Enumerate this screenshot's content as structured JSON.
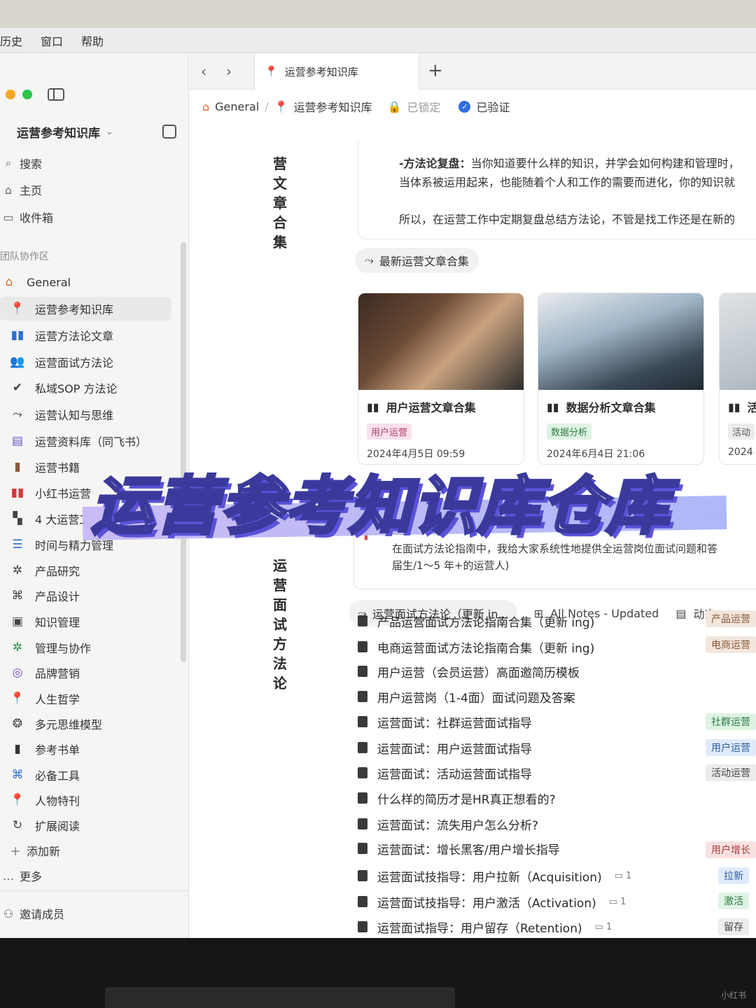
{
  "menubar": {
    "items": [
      "历史",
      "窗口",
      "帮助"
    ]
  },
  "sidebar": {
    "workspace_title": "运营参考知识库",
    "nav": [
      {
        "label": "搜索",
        "icon": "search-icon"
      },
      {
        "label": "主页",
        "icon": "home-icon"
      },
      {
        "label": "收件箱",
        "icon": "inbox-icon"
      }
    ],
    "section_label": "团队协作区",
    "tree": [
      {
        "label": "General",
        "icon": "house-icon"
      },
      {
        "label": "运营参考知识库",
        "icon": "pin-icon"
      },
      {
        "label": "运营方法论文章",
        "icon": "book-icon"
      },
      {
        "label": "运营面试方法论",
        "icon": "people-icon"
      },
      {
        "label": "私域SOP 方法论",
        "icon": "badge-check-icon"
      },
      {
        "label": "运营认知与思维",
        "icon": "route-icon"
      },
      {
        "label": "运营资料库（同飞书）",
        "icon": "folder-icon"
      },
      {
        "label": "运营书籍",
        "icon": "bookmark-icon"
      },
      {
        "label": "小红书运营",
        "icon": "book-open-icon"
      },
      {
        "label": "4 大运营工",
        "icon": "chart-icon"
      },
      {
        "label": "时间与精力管理",
        "icon": "list-icon"
      },
      {
        "label": "产品研究",
        "icon": "gear-icon"
      },
      {
        "label": "产品设计",
        "icon": "command-icon"
      },
      {
        "label": "知识管理",
        "icon": "knowledge-icon"
      },
      {
        "label": "管理与协作",
        "icon": "gear-green-icon"
      },
      {
        "label": "品牌营销",
        "icon": "target-icon"
      },
      {
        "label": "人生哲学",
        "icon": "pin-blue-icon"
      },
      {
        "label": "多元思维模型",
        "icon": "brain-icon"
      },
      {
        "label": "参考书单",
        "icon": "book-dark-icon"
      },
      {
        "label": "必备工具",
        "icon": "command-blue-icon"
      },
      {
        "label": "人物特刊",
        "icon": "pin-red-icon"
      },
      {
        "label": "扩展阅读",
        "icon": "refresh-icon"
      }
    ],
    "add_new": "添加新",
    "more": "更多",
    "invite": "邀请成员"
  },
  "tabs": {
    "active_tab": "运营参考知识库"
  },
  "breadcrumb": {
    "root": "General",
    "page": "运营参考知识库",
    "locked": "已锁定",
    "verified": "已验证"
  },
  "content": {
    "vertical_heading_1": [
      "营",
      "文",
      "章",
      "合",
      "集"
    ],
    "vertical_heading_2": [
      "运",
      "营",
      "面",
      "试",
      "方",
      "法",
      "论"
    ],
    "text_block": {
      "line1_bold": "-方法论复盘：",
      "line1_rest": "当你知道要什么样的知识，并学会如何构建和管理时，",
      "line2": "当体系被运用起来，也能随着个人和工作的需要而进化，你的知识就",
      "line3": "所以，在运营工作中定期复盘总结方法论，不管是找工作还是在新的"
    },
    "gallery_label": "最新运营文章合集",
    "cards": [
      {
        "title": "用户运营文章合集",
        "tag": "用户运营",
        "tag_bg": "#f9e1ec",
        "tag_color": "#b03a6f",
        "date": "2024年4月5日 09:59"
      },
      {
        "title": "数据分析文章合集",
        "tag": "数据分析",
        "tag_bg": "#dff3e4",
        "tag_color": "#2c7a43",
        "date": "2024年6月4日 21:06"
      },
      {
        "title": "活",
        "tag": "活动",
        "tag_bg": "#ececec",
        "tag_color": "#555",
        "date": "2024"
      }
    ],
    "snippet": {
      "line1": "在面试方法论指南中，我给大家系统性地提供全运营岗位面试问题和答",
      "line2": "届生/1～5 年+的运营人)"
    },
    "view_tabs": {
      "active": "运营面试方法论（更新 in...",
      "all_notes": "All Notes - Updated",
      "activity": "动态"
    },
    "list": [
      {
        "title": "产品运营面试方法论指南合集（更新 ing)",
        "tag": "产品运营",
        "tag_bg": "#f3e6dc",
        "tag_color": "#8a5a3a",
        "comments": ""
      },
      {
        "title": "电商运营面试方法论指南合集（更新 ing)",
        "tag": "电商运营",
        "tag_bg": "#f3e6dc",
        "tag_color": "#8a5a3a",
        "comments": ""
      },
      {
        "title": "用户运营（会员运营）高面邀简历模板",
        "tag": "",
        "tag_bg": "",
        "tag_color": "",
        "comments": ""
      },
      {
        "title": "用户运营岗（1-4面）面试问题及答案",
        "tag": "",
        "tag_bg": "",
        "tag_color": "",
        "comments": ""
      },
      {
        "title": "运营面试：社群运营面试指导",
        "tag": "社群运营",
        "tag_bg": "#dff3e4",
        "tag_color": "#2c7a43",
        "comments": ""
      },
      {
        "title": "运营面试：用户运营面试指导",
        "tag": "用户运营",
        "tag_bg": "#e0ebfa",
        "tag_color": "#2c5ea8",
        "comments": ""
      },
      {
        "title": "运营面试：活动运营面试指导",
        "tag": "活动运营",
        "tag_bg": "#ececec",
        "tag_color": "#444",
        "comments": ""
      },
      {
        "title": "什么样的简历才是HR真正想看的?",
        "tag": "",
        "tag_bg": "",
        "tag_color": "",
        "comments": ""
      },
      {
        "title": "运营面试：流失用户怎么分析?",
        "tag": "",
        "tag_bg": "",
        "tag_color": "",
        "comments": ""
      },
      {
        "title": "运营面试：增长黑客/用户增长指导",
        "tag": "用户增长",
        "tag_bg": "#f9e1e1",
        "tag_color": "#a83a3a",
        "comments": ""
      },
      {
        "title": "运营面试技指导：用户拉新（Acquisition)",
        "tag": "拉新",
        "tag_bg": "#e0ebfa",
        "tag_color": "#2c5ea8",
        "comments": "1"
      },
      {
        "title": "运营面试技指导：用户激活（Activation)",
        "tag": "激活",
        "tag_bg": "#dff3e4",
        "tag_color": "#2c7a43",
        "comments": "1"
      },
      {
        "title": "运营面试指导：用户留存（Retention)",
        "tag": "留存",
        "tag_bg": "#ececec",
        "tag_color": "#444",
        "comments": "1"
      }
    ]
  },
  "overlay": {
    "title": "运营参考知识库仓库"
  },
  "watermark": "小红书"
}
